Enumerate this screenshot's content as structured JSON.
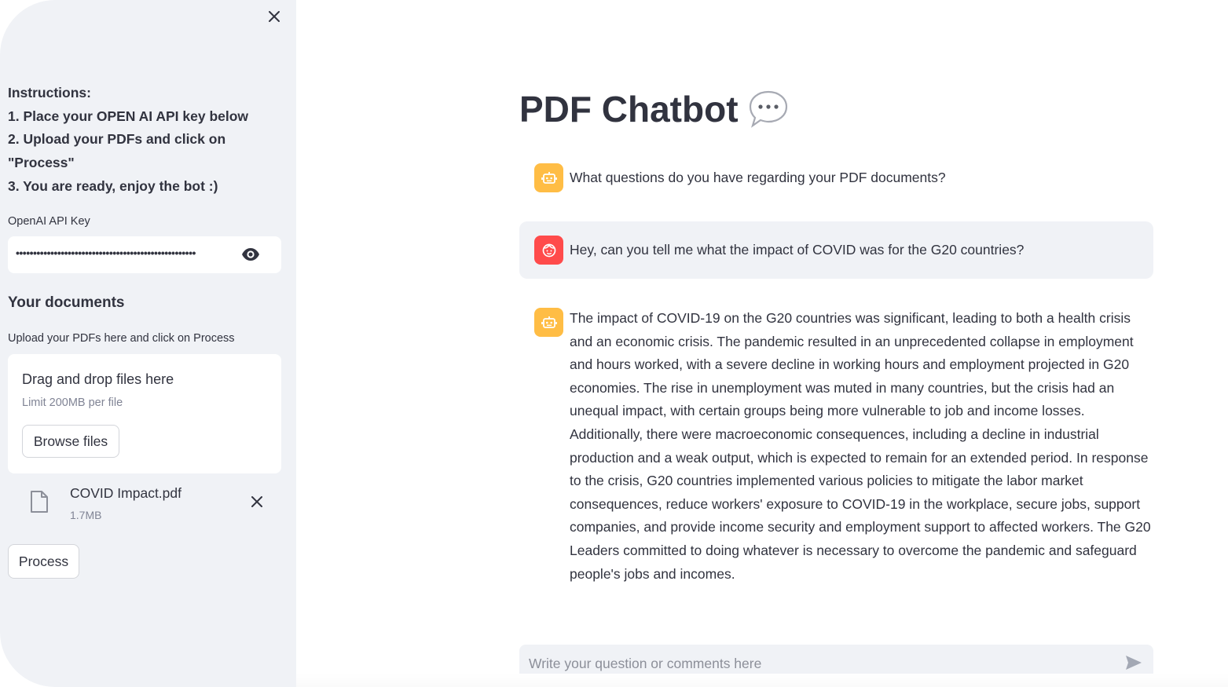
{
  "sidebar": {
    "instructions": [
      "Instructions:",
      "1. Place your OPEN AI API key below",
      "2. Upload your PDFs and click on",
      "\"Process\"",
      "3. You are ready, enjoy the bot :)"
    ],
    "api_key_label": "OpenAI API Key",
    "api_key_masked": "••••••••••••••••••••••••••••••••••••••••••••••••••••",
    "documents_heading": "Your documents",
    "upload_label": "Upload your PDFs here and click on Process",
    "dropzone_title": "Drag and drop files here",
    "dropzone_limit": "Limit 200MB per file",
    "browse_label": "Browse files",
    "file": {
      "name": "COVID Impact.pdf",
      "size": "1.7MB"
    },
    "process_label": "Process"
  },
  "main": {
    "title": "PDF Chatbot",
    "messages": [
      {
        "role": "assistant",
        "text": "What questions do you have regarding your PDF documents?"
      },
      {
        "role": "user",
        "text": "Hey, can you tell me what the impact of COVID was for the G20 countries?"
      },
      {
        "role": "assistant",
        "text": "The impact of COVID-19 on the G20 countries was significant, leading to both a health crisis and an economic crisis. The pandemic resulted in an unprecedented collapse in employment and hours worked, with a severe decline in working hours and employment projected in G20 economies. The rise in unemployment was muted in many countries, but the crisis had an unequal impact, with certain groups being more vulnerable to job and income losses. Additionally, there were macroeconomic consequences, including a decline in industrial production and a weak output, which is expected to remain for an extended period. In response to the crisis, G20 countries implemented various policies to mitigate the labor market consequences, reduce workers' exposure to COVID-19 in the workplace, secure jobs, support companies, and provide income security and employment support to affected workers. The G20 Leaders committed to doing whatever is necessary to overcome the pandemic and safeguard people's jobs and incomes."
      }
    ],
    "chat_placeholder": "Write your question or comments here"
  },
  "colors": {
    "sidebar_bg": "#f0f2f6",
    "bot_avatar": "#ffbd45",
    "user_avatar": "#ff4b4b",
    "text": "#31333f"
  },
  "icons": [
    "close-icon",
    "eye-icon",
    "file-icon",
    "remove-file-icon",
    "speech-bubble-icon",
    "robot-icon",
    "smiley-icon",
    "send-icon"
  ]
}
